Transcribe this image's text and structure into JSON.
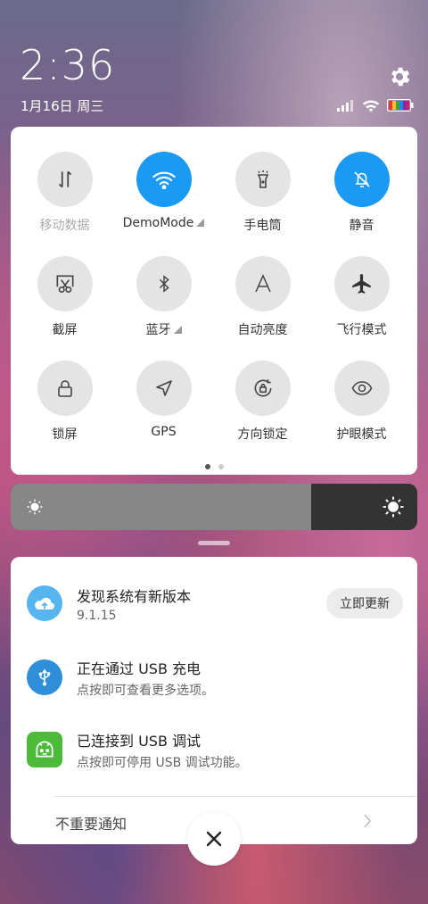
{
  "header": {
    "time": "2:36",
    "date": "1月16日 周三"
  },
  "quick_toggles": [
    {
      "label": "移动数据",
      "icon": "mobile-data-icon",
      "active": false,
      "dimmed": true
    },
    {
      "label": "DemoMode",
      "icon": "wifi-icon",
      "active": true,
      "has_more": true
    },
    {
      "label": "手电筒",
      "icon": "flashlight-icon",
      "active": false
    },
    {
      "label": "静音",
      "icon": "bell-off-icon",
      "active": true
    },
    {
      "label": "截屏",
      "icon": "screenshot-icon",
      "active": false
    },
    {
      "label": "蓝牙",
      "icon": "bluetooth-icon",
      "active": false,
      "has_more": true
    },
    {
      "label": "自动亮度",
      "icon": "auto-brightness-icon",
      "active": false
    },
    {
      "label": "飞行模式",
      "icon": "airplane-icon",
      "active": false
    },
    {
      "label": "锁屏",
      "icon": "lock-icon",
      "active": false
    },
    {
      "label": "GPS",
      "icon": "location-icon",
      "active": false
    },
    {
      "label": "方向锁定",
      "icon": "rotation-lock-icon",
      "active": false
    },
    {
      "label": "护眼模式",
      "icon": "eye-icon",
      "active": false
    }
  ],
  "page_indicator": {
    "current": 1,
    "total": 2
  },
  "brightness": {
    "level": 0.74
  },
  "notifications": [
    {
      "title": "发现系统有新版本",
      "subtitle": "9.1.15",
      "icon": "cloud-update-icon",
      "action_label": "立即更新"
    },
    {
      "title": "正在通过 USB 充电",
      "subtitle": "点按即可查看更多选项。",
      "icon": "usb-icon"
    },
    {
      "title": "已连接到 USB 调试",
      "subtitle": "点按即可停用 USB 调试功能。",
      "icon": "android-debug-icon"
    }
  ],
  "minor_notifications_label": "不重要通知",
  "colors": {
    "accent": "#1a9af2",
    "usb_icon": "#2e8fd8",
    "android_icon": "#4cbb3a",
    "cloud_icon": "#56b4ee"
  }
}
